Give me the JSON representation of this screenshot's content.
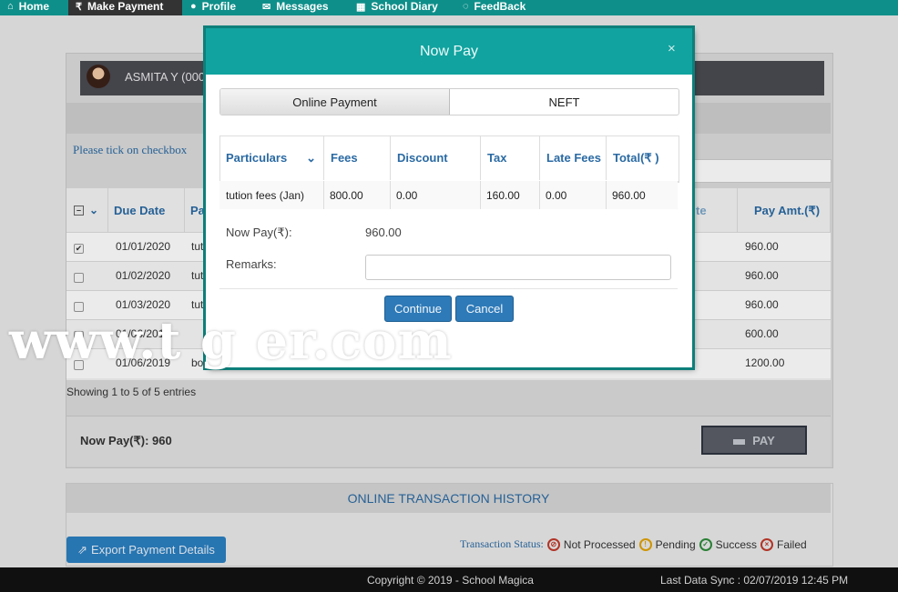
{
  "nav": {
    "items": [
      {
        "label": "Home",
        "icon": "home-icon"
      },
      {
        "label": "Make Payment",
        "icon": "rupee-icon"
      },
      {
        "label": "Profile",
        "icon": "user-icon"
      },
      {
        "label": "Messages",
        "icon": "envelope-icon"
      },
      {
        "label": "School Diary",
        "icon": "calendar-icon"
      },
      {
        "label": "FeedBack",
        "icon": "chat-icon"
      }
    ]
  },
  "student": {
    "name": "ASMITA Y (000"
  },
  "instructions": "Please tick on checkbox",
  "table": {
    "headers": {
      "due_date": "Due Date",
      "particulars": "Pa",
      "late": "te",
      "pay_amt": "Pay Amt.(₹)"
    },
    "rows": [
      {
        "checked": true,
        "due_date": "01/01/2020",
        "particular": "tut",
        "pay_amt": "960.00"
      },
      {
        "checked": false,
        "due_date": "01/02/2020",
        "particular": "tut",
        "pay_amt": "960.00"
      },
      {
        "checked": false,
        "due_date": "01/03/2020",
        "particular": "tut",
        "pay_amt": "960.00"
      },
      {
        "checked": false,
        "due_date": "01/06/2019",
        "particular": "",
        "pay_amt": "600.00"
      },
      {
        "checked": false,
        "due_date": "01/06/2019",
        "particular": "bo",
        "pay_amt": "1200.00"
      }
    ],
    "showing": "Showing 1 to 5 of 5 entries"
  },
  "now_pay_summary": "Now Pay(₹): 960",
  "pay_button": "PAY",
  "history": {
    "title": "ONLINE TRANSACTION HISTORY",
    "export_label": "Export Payment Details",
    "status_label": "Transaction Status:",
    "statuses": [
      {
        "label": "Not Processed",
        "color": "#c0392b"
      },
      {
        "label": "Pending",
        "color": "#e0a100"
      },
      {
        "label": "Success",
        "color": "#2e8b3a"
      },
      {
        "label": "Failed",
        "color": "#c0392b"
      }
    ]
  },
  "footer": {
    "copyright": "Copyright © 2019 - School Magica",
    "sync": "Last Data Sync : 02/07/2019 12:45 PM"
  },
  "modal": {
    "title": "Now Pay",
    "close": "×",
    "tabs": [
      "Online Payment",
      "NEFT"
    ],
    "columns": {
      "particulars": "Particulars",
      "fees": "Fees",
      "discount": "Discount",
      "tax": "Tax",
      "late_fees": "Late Fees",
      "total": "Total(₹ )"
    },
    "row": {
      "particulars": "tution fees (Jan)",
      "fees": "800.00",
      "discount": "0.00",
      "tax": "160.00",
      "late_fees": "0.00",
      "total": "960.00"
    },
    "now_pay_label": "Now Pay(₹):",
    "now_pay_value": "960.00",
    "remarks_label": "Remarks:",
    "remarks_value": "",
    "continue": "Continue",
    "cancel": "Cancel"
  },
  "watermark": "www.t                 g                er.com",
  "colors": {
    "teal": "#11a39f",
    "link_blue": "#2a6aa3",
    "button_blue": "#2e7ab8"
  }
}
